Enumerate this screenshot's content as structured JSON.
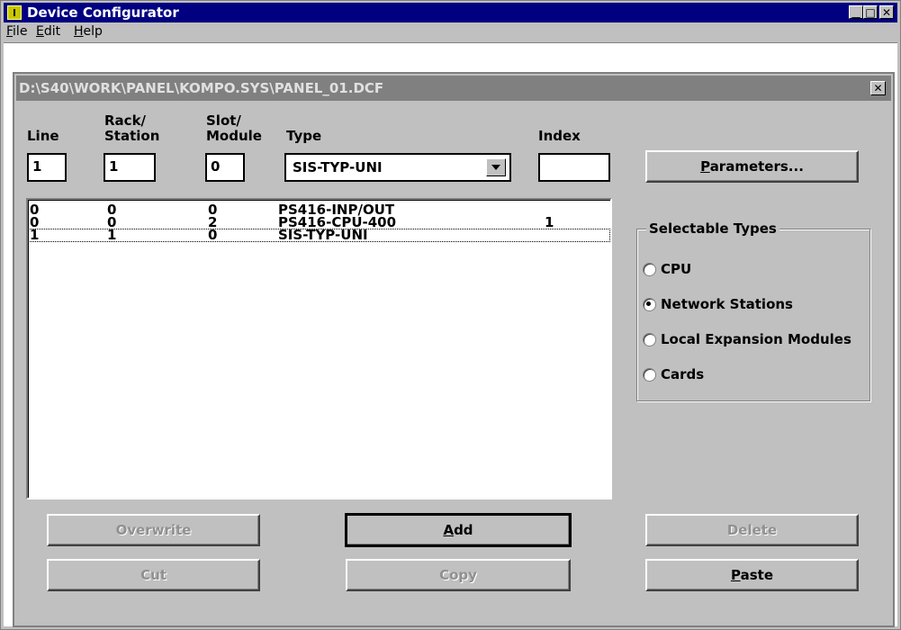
{
  "window": {
    "title": "Device Configurator",
    "colors": {
      "title_bar": "#000080",
      "face": "#c0c0c0",
      "inner_title": "#808080"
    }
  },
  "menu": [
    {
      "label": "File",
      "mnemonic": "F"
    },
    {
      "label": "Edit",
      "mnemonic": "E"
    },
    {
      "label": "Help",
      "mnemonic": "H"
    }
  ],
  "child_window": {
    "title": "D:\\S40\\WORK\\PANEL\\KOMPO.SYS\\PANEL_01.DCF"
  },
  "headers": {
    "line": "Line",
    "rack_station_1": "Rack/",
    "rack_station_2": "Station",
    "slot_module_1": "Slot/",
    "slot_module_2": "Module",
    "type": "Type",
    "index": "Index"
  },
  "inputs": {
    "line": "1",
    "rack": "1",
    "slot": "0",
    "type": "SIS-TYP-UNI",
    "index": ""
  },
  "table": {
    "rows": [
      {
        "line": "0",
        "rack": "0",
        "slot": "0",
        "type": "PS416-INP/OUT",
        "index": ""
      },
      {
        "line": "0",
        "rack": "0",
        "slot": "2",
        "type": "PS416-CPU-400",
        "index": "1"
      },
      {
        "line": "1",
        "rack": "1",
        "slot": "0",
        "type": "SIS-TYP-UNI",
        "index": ""
      }
    ],
    "selected_row": 2
  },
  "buttons": {
    "parameters": "Parameters...",
    "overwrite": "Overwrite",
    "add": "Add",
    "delete": "Delete",
    "cut": "Cut",
    "copy": "Copy",
    "paste": "Paste"
  },
  "selectable_types": {
    "title": "Selectable Types",
    "options": [
      "CPU",
      "Network Stations",
      "Local Expansion Modules",
      "Cards"
    ],
    "selected": 1
  }
}
